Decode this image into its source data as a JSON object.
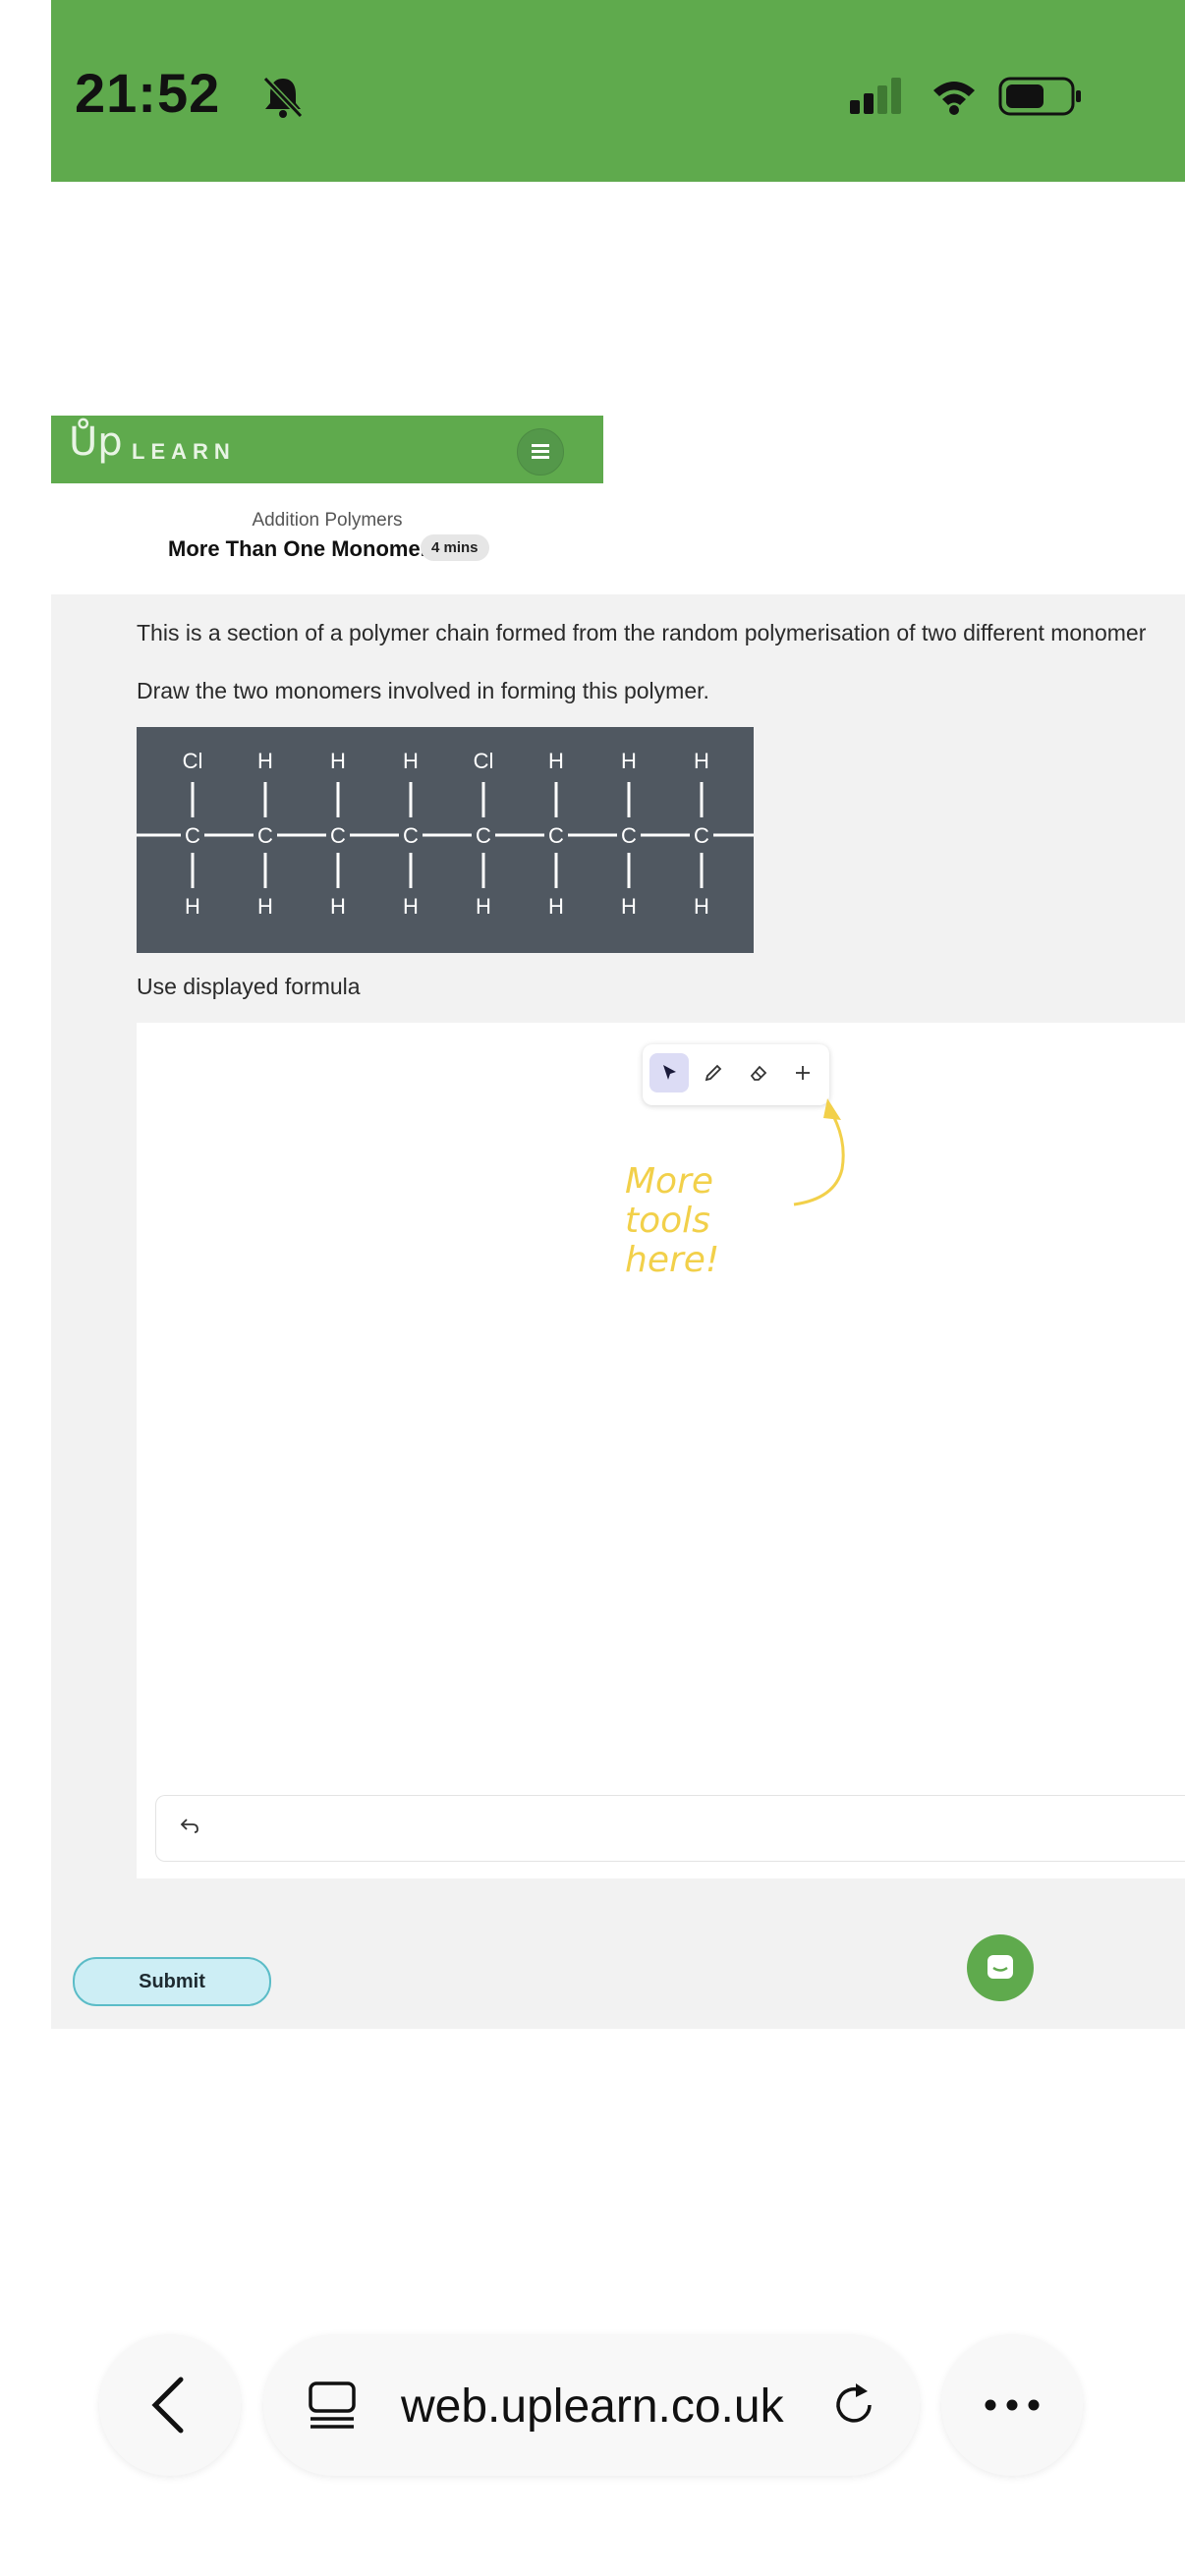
{
  "status_bar": {
    "time": "21:52",
    "background": "#5faa4d",
    "icons": [
      "bell-slash-icon",
      "signal-icon",
      "wifi-icon",
      "battery-icon"
    ]
  },
  "header": {
    "logo_up": "Ůp",
    "logo_learn": "LEARN",
    "menu_icon": "hamburger-icon",
    "background": "#5faa4d"
  },
  "lesson": {
    "course": "Addition Polymers",
    "title": "More Than One Monomer",
    "duration": "4 mins"
  },
  "question": {
    "text": "This is a section of a polymer chain formed from the random polymerisation of two different monomer",
    "instruction": "Draw the two monomers involved in forming this polymer.",
    "hint": "Use displayed formula"
  },
  "polymer": {
    "top_atoms": [
      "Cl",
      "H",
      "H",
      "H",
      "Cl",
      "H",
      "H",
      "H"
    ],
    "chain_atom": "C",
    "bottom_atoms": [
      "H",
      "H",
      "H",
      "H",
      "H",
      "H",
      "H",
      "H"
    ]
  },
  "drawing": {
    "tools": [
      "cursor-icon",
      "pencil-icon",
      "eraser-icon",
      "plus-icon"
    ],
    "note_lines": [
      "More",
      "tools",
      "here!"
    ],
    "undo_icon": "undo-icon"
  },
  "actions": {
    "submit_label": "Submit",
    "chat_icon": "chat-icon"
  },
  "browser": {
    "url": "web.uplearn.co.uk"
  }
}
